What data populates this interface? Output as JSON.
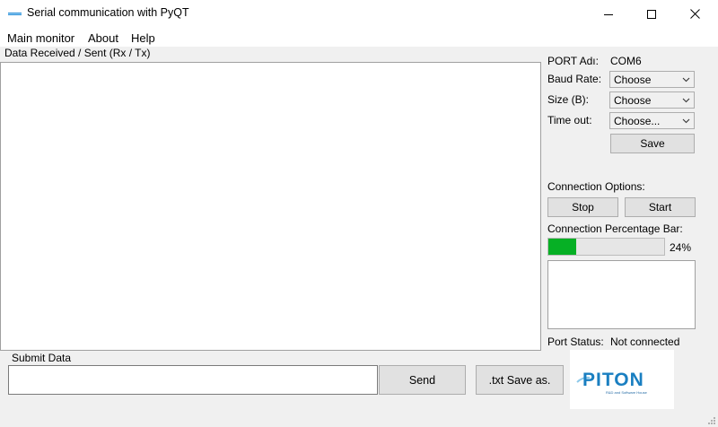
{
  "window": {
    "title": "Serial communication with PyQT"
  },
  "menu": {
    "items": [
      "Main monitor",
      "About",
      "Help"
    ]
  },
  "data_panel": {
    "label": "Data Received / Sent (Rx / Tx)"
  },
  "settings": {
    "port_label": "PORT Adı:",
    "port_value": "COM6",
    "baud_label": "Baud Rate:",
    "baud_value": "Choose",
    "size_label": "Size (B):",
    "size_value": "Choose",
    "timeout_label": "Time out:",
    "timeout_value": "Choose...",
    "save_label": "Save"
  },
  "connection": {
    "options_label": "Connection Options:",
    "stop_label": "Stop",
    "start_label": "Start",
    "progress_label": "Connection Percentage Bar:",
    "progress_percent": 24,
    "progress_text": "24%",
    "progress_color": "#06b025",
    "status_label": "Port Status:",
    "status_value": "Not connected"
  },
  "submit": {
    "label": "Submit Data",
    "input_value": "",
    "send_label": "Send",
    "save_txt_label": ".txt Save as."
  },
  "logo": {
    "text": "PITON",
    "tagline": "R&D and Software House",
    "color": "#1a7fc1"
  }
}
